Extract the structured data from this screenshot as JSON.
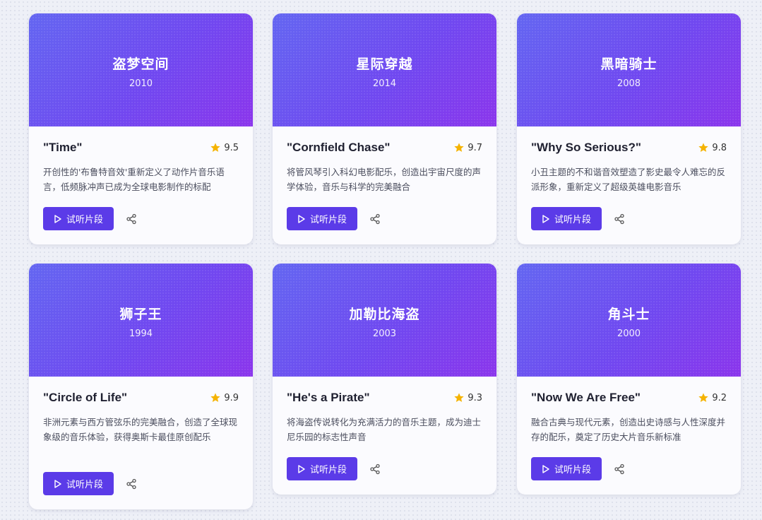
{
  "cards": [
    {
      "movie": "盗梦空间",
      "year": "2010",
      "track": "\"Time\"",
      "rating": "9.5",
      "desc": "开创性的'布鲁特音效'重新定义了动作片音乐语言，低频脉冲声已成为全球电影制作的标配",
      "button": "试听片段"
    },
    {
      "movie": "星际穿越",
      "year": "2014",
      "track": "\"Cornfield Chase\"",
      "rating": "9.7",
      "desc": "将管风琴引入科幻电影配乐，创造出宇宙尺度的声学体验，音乐与科学的完美融合",
      "button": "试听片段"
    },
    {
      "movie": "黑暗骑士",
      "year": "2008",
      "track": "\"Why So Serious?\"",
      "rating": "9.8",
      "desc": "小丑主题的不和谐音效塑造了影史最令人难忘的反派形象，重新定义了超级英雄电影音乐",
      "button": "试听片段"
    },
    {
      "movie": "狮子王",
      "year": "1994",
      "track": "\"Circle of Life\"",
      "rating": "9.9",
      "desc": "非洲元素与西方管弦乐的完美融合，创造了全球现象级的音乐体验，获得奥斯卡最佳原创配乐",
      "button": "试听片段"
    },
    {
      "movie": "加勒比海盗",
      "year": "2003",
      "track": "\"He's a Pirate\"",
      "rating": "9.3",
      "desc": "将海盗传说转化为充满活力的音乐主题，成为迪士尼乐园的标志性声音",
      "button": "试听片段"
    },
    {
      "movie": "角斗士",
      "year": "2000",
      "track": "\"Now We Are Free\"",
      "rating": "9.2",
      "desc": "融合古典与现代元素，创造出史诗感与人性深度并存的配乐，奠定了历史大片音乐新标准",
      "button": "试听片段"
    }
  ],
  "colors": {
    "accent": "#5b3be8",
    "hero_start": "#6366f1",
    "hero_end": "#8b35ec",
    "star": "#f5b301"
  }
}
